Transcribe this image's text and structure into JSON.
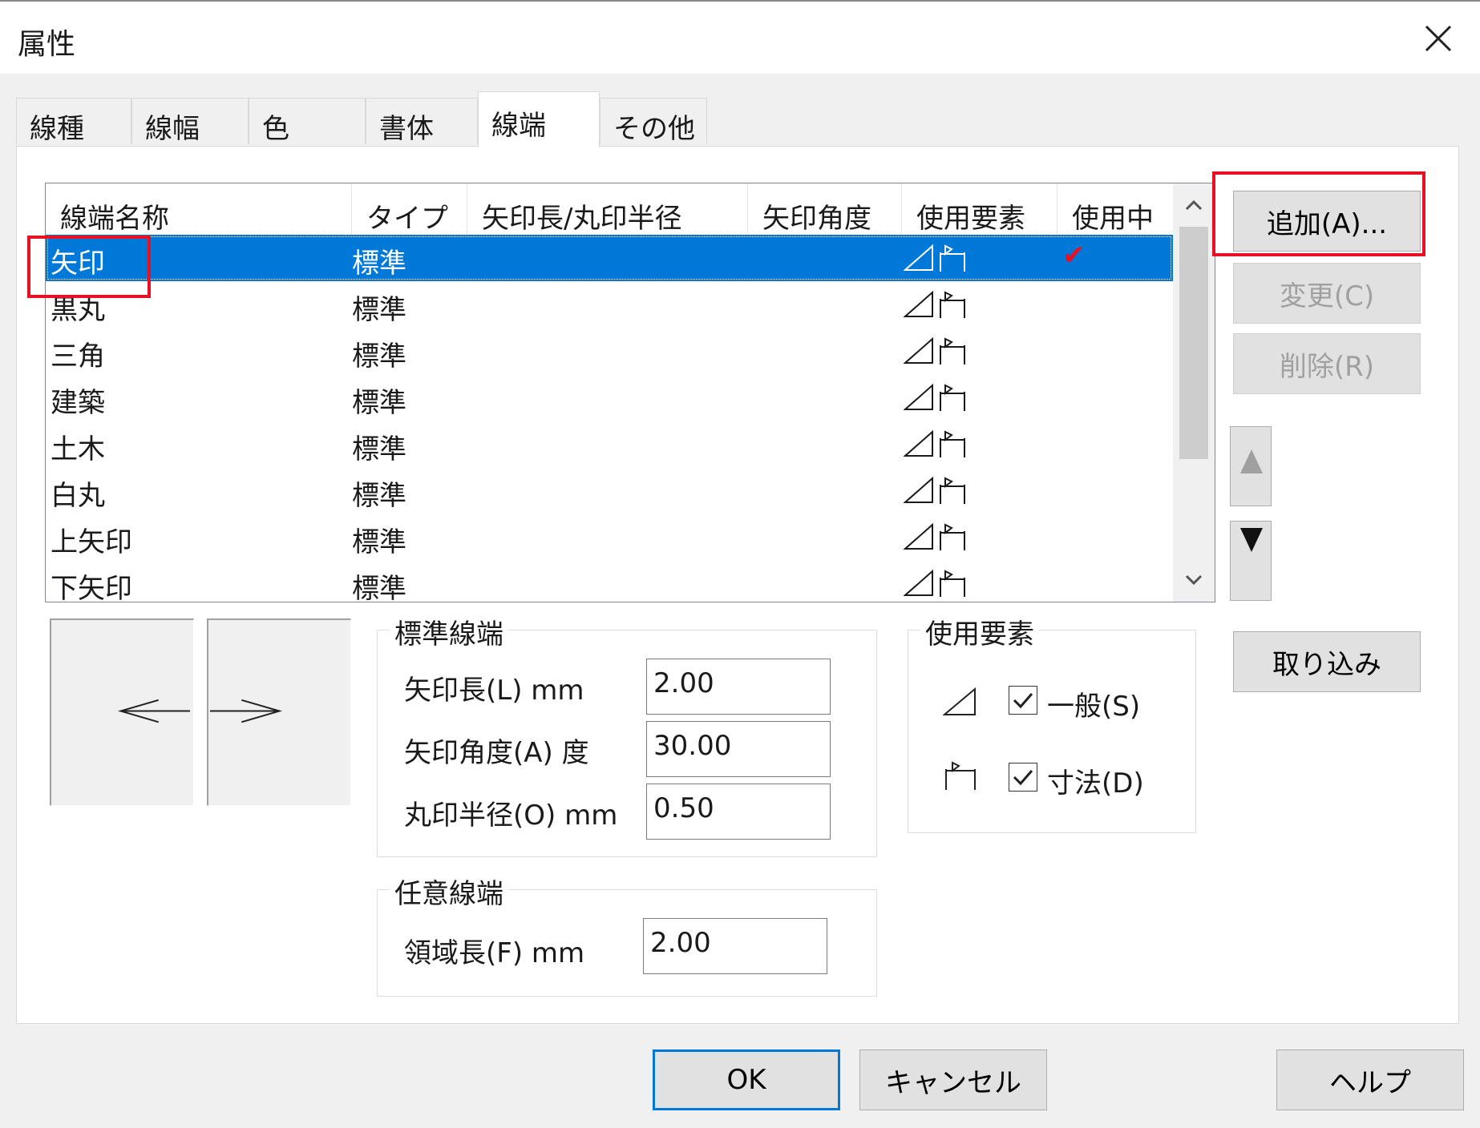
{
  "window": {
    "title": "属性"
  },
  "tabs": [
    {
      "label": "線種"
    },
    {
      "label": "線幅"
    },
    {
      "label": "色"
    },
    {
      "label": "書体"
    },
    {
      "label": "線端",
      "active": true
    },
    {
      "label": "その他"
    }
  ],
  "list": {
    "columns": [
      "線端名称",
      "タイプ",
      "矢印長/丸印半径",
      "矢印角度",
      "使用要素",
      "使用中"
    ],
    "rows": [
      {
        "name": "矢印",
        "type": "標準",
        "elements_icon": "triangle-and-dimension-icons",
        "in_use": "✔",
        "selected": true
      },
      {
        "name": "黒丸",
        "type": "標準",
        "elements_icon": "triangle-and-dimension-icons",
        "in_use": ""
      },
      {
        "name": "三角",
        "type": "標準",
        "elements_icon": "triangle-and-dimension-icons",
        "in_use": ""
      },
      {
        "name": "建築",
        "type": "標準",
        "elements_icon": "triangle-and-dimension-icons",
        "in_use": ""
      },
      {
        "name": "土木",
        "type": "標準",
        "elements_icon": "triangle-and-dimension-icons",
        "in_use": ""
      },
      {
        "name": "白丸",
        "type": "標準",
        "elements_icon": "triangle-and-dimension-icons",
        "in_use": ""
      },
      {
        "name": "上矢印",
        "type": "標準",
        "elements_icon": "triangle-and-dimension-icons",
        "in_use": ""
      },
      {
        "name": "下矢印",
        "type": "標準",
        "elements_icon": "triangle-and-dimension-icons",
        "in_use": ""
      }
    ]
  },
  "buttons": {
    "add": "追加(A)...",
    "change": "変更(C)",
    "delete": "削除(R)",
    "import": "取り込み",
    "ok": "OK",
    "cancel": "キャンセル",
    "help": "ヘルプ"
  },
  "standard_end": {
    "title": "標準線端",
    "arrow_length_label": "矢印長(L) mm",
    "arrow_length_value": "2.00",
    "arrow_angle_label": "矢印角度(A) 度",
    "arrow_angle_value": "30.00",
    "circle_radius_label": "丸印半径(O) mm",
    "circle_radius_value": "0.50"
  },
  "custom_end": {
    "title": "任意線端",
    "area_length_label": "領域長(F) mm",
    "area_length_value": "2.00"
  },
  "use_elements": {
    "title": "使用要素",
    "general_label": "一般(S)",
    "general_checked": true,
    "dimension_label": "寸法(D)",
    "dimension_checked": true
  },
  "colors": {
    "selection": "#0078d7",
    "highlight_box": "#e81123",
    "in_use_check": "#e81123"
  }
}
